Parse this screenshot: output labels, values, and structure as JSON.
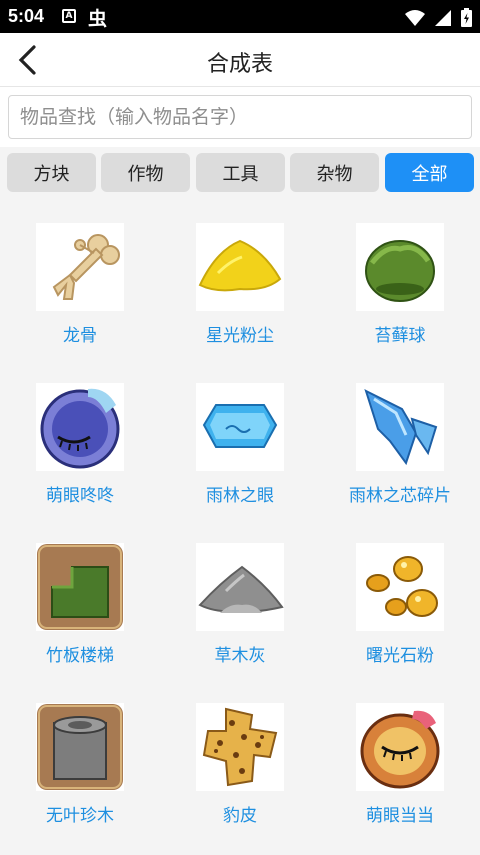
{
  "status": {
    "time": "5:04",
    "notif_a": "A",
    "notif_bug": "虫"
  },
  "header": {
    "title": "合成表"
  },
  "search": {
    "placeholder": "物品查找（输入物品名字）"
  },
  "tabs": [
    {
      "label": "方块",
      "active": false
    },
    {
      "label": "作物",
      "active": false
    },
    {
      "label": "工具",
      "active": false
    },
    {
      "label": "杂物",
      "active": false
    },
    {
      "label": "全部",
      "active": true
    }
  ],
  "items": [
    {
      "name": "龙骨",
      "icon": "bone-icon"
    },
    {
      "name": "星光粉尘",
      "icon": "yellow-dust-icon"
    },
    {
      "name": "苔藓球",
      "icon": "moss-ball-icon"
    },
    {
      "name": "萌眼咚咚",
      "icon": "blue-eye-egg-icon"
    },
    {
      "name": "雨林之眼",
      "icon": "blue-gem-icon"
    },
    {
      "name": "雨林之芯碎片",
      "icon": "blue-crystal-shard-icon"
    },
    {
      "name": "竹板楼梯",
      "icon": "bamboo-stairs-icon"
    },
    {
      "name": "草木灰",
      "icon": "ash-pile-icon"
    },
    {
      "name": "曙光石粉",
      "icon": "amber-stones-icon"
    },
    {
      "name": "无叶珍木",
      "icon": "gray-wood-block-icon"
    },
    {
      "name": "豹皮",
      "icon": "leopard-hide-icon"
    },
    {
      "name": "萌眼当当",
      "icon": "orange-eye-egg-icon"
    }
  ],
  "colors": {
    "accent": "#1e90f6",
    "item_text": "#1e8fe0",
    "tab_inactive": "#dcdcdc"
  }
}
